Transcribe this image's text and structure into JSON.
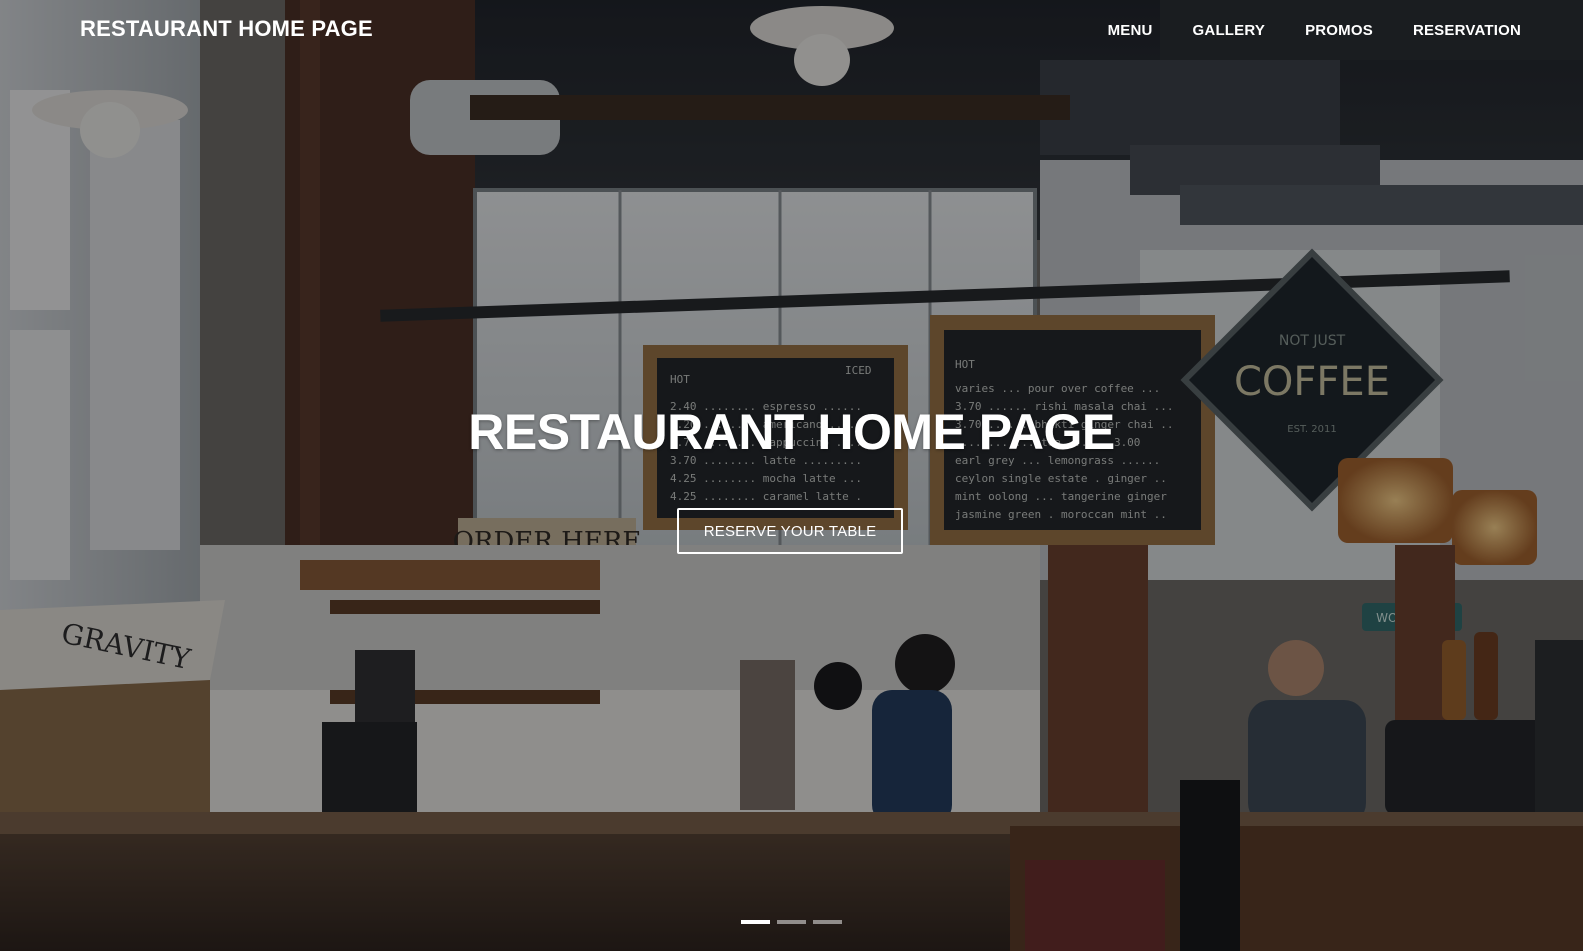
{
  "header": {
    "brand": "RESTAURANT HOME PAGE",
    "nav": [
      {
        "label": "MENU"
      },
      {
        "label": "GALLERY"
      },
      {
        "label": "PROMOS"
      },
      {
        "label": "RESERVATION"
      }
    ]
  },
  "hero": {
    "title": "RESTAURANT HOME PAGE",
    "cta_label": "RESERVE YOUR TABLE",
    "background_image": "cafe-interior-photo",
    "signs": {
      "order": "ORDER HERE",
      "coffee_top": "NOT JUST",
      "coffee_main": "COFFEE",
      "coffee_bottom": "EST. 2011",
      "board_left_hot": "HOT",
      "board_left_iced": "ICED",
      "board_right_hot": "HOT",
      "box": "GRAVITY",
      "workzone": "WORKZONE"
    }
  },
  "carousel": {
    "slides": 3,
    "active_index": 0
  },
  "colors": {
    "text": "#ffffff",
    "overlay": "rgba(10,10,12,0.42)"
  }
}
